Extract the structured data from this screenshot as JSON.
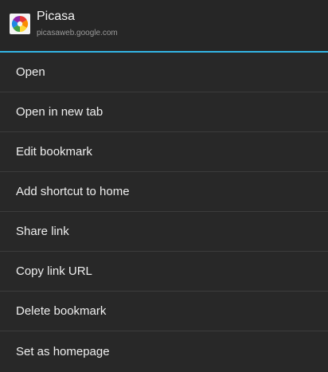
{
  "header": {
    "title": "Picasa",
    "url": "picasaweb.google.com",
    "icon": "picasa-logo-icon",
    "accent_color": "#33b5e5"
  },
  "menu": {
    "items": [
      {
        "label": "Open"
      },
      {
        "label": "Open in new tab"
      },
      {
        "label": "Edit bookmark"
      },
      {
        "label": "Add shortcut to home"
      },
      {
        "label": "Share link"
      },
      {
        "label": "Copy link URL"
      },
      {
        "label": "Delete bookmark"
      },
      {
        "label": "Set as homepage"
      }
    ]
  }
}
